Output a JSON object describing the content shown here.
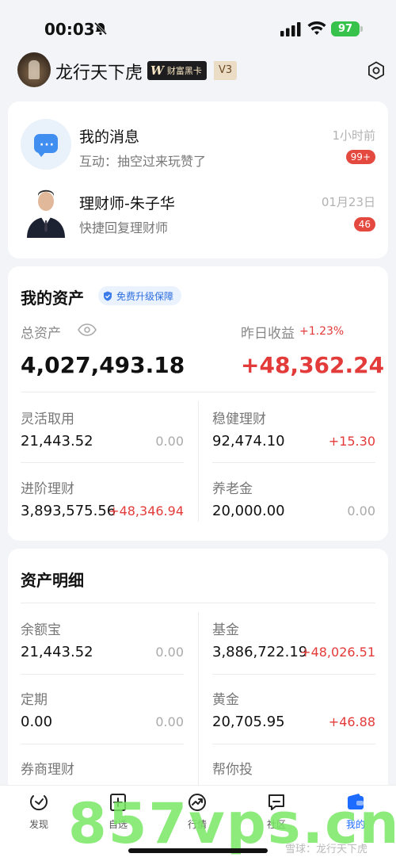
{
  "status": {
    "time": "00:03",
    "battery": "97"
  },
  "profile": {
    "username": "龙行天下虎",
    "badge_mark": "W",
    "badge_text": "财富黑卡",
    "level": "V3"
  },
  "messages": [
    {
      "title": "我的消息",
      "subtitle": "互动：抽空过来玩赞了",
      "time": "1小时前",
      "count": "99+"
    },
    {
      "title": "理财师-朱子华",
      "subtitle": "快捷回复理财师",
      "time": "01月23日",
      "count": "46"
    }
  ],
  "assets": {
    "title": "我的资产",
    "guard": "免费升级保障",
    "total_label": "总资产",
    "total": "4,027,493.18",
    "yesterday_label": "昨日收益",
    "yesterday_pct": "+1.23%",
    "yesterday_value": "+48,362.24",
    "items": [
      {
        "name": "灵活取用",
        "value": "21,443.52",
        "change": "0.00"
      },
      {
        "name": "稳健理财",
        "value": "92,474.10",
        "change": "+15.30"
      },
      {
        "name": "进阶理财",
        "value": "3,893,575.56",
        "change": "+48,346.94"
      },
      {
        "name": "养老金",
        "value": "20,000.00",
        "change": "0.00"
      }
    ]
  },
  "details": {
    "title": "资产明细",
    "items": [
      {
        "name": "余额宝",
        "value": "21,443.52",
        "change": "0.00"
      },
      {
        "name": "基金",
        "value": "3,886,722.19",
        "change": "+48,026.51"
      },
      {
        "name": "定期",
        "value": "0.00",
        "change": "0.00"
      },
      {
        "name": "黄金",
        "value": "20,705.95",
        "change": "+46.88"
      },
      {
        "name": "券商理财",
        "value": "",
        "change": ""
      },
      {
        "name": "帮你投",
        "value": "",
        "change": ""
      }
    ]
  },
  "tabs": [
    {
      "label": "发现",
      "icon": "discover-icon"
    },
    {
      "label": "自选",
      "icon": "watchlist-icon"
    },
    {
      "label": "行情",
      "icon": "market-icon"
    },
    {
      "label": "社区",
      "icon": "community-icon"
    },
    {
      "label": "我的",
      "icon": "wallet-icon",
      "active": true
    }
  ],
  "watermark": {
    "big": "857vps.cn",
    "small": "雪球：龙行天下虎"
  },
  "colors": {
    "red": "#e33a3a",
    "blue": "#1e6bff",
    "battery": "#36c24b"
  }
}
